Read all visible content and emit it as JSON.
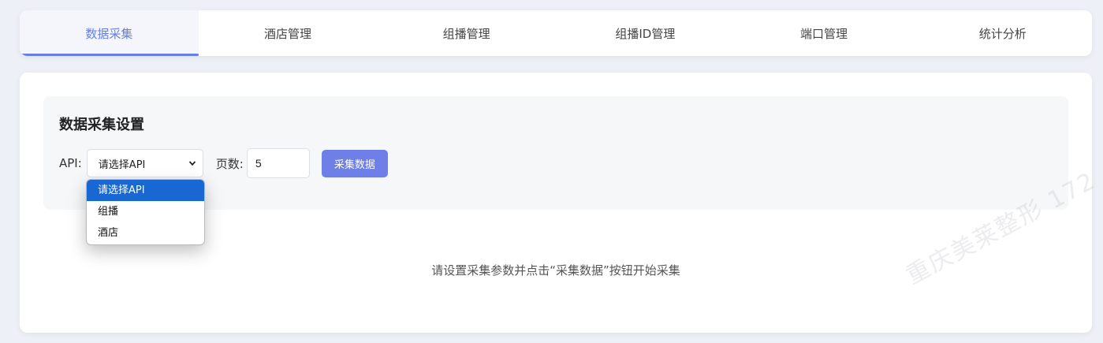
{
  "tabs": [
    {
      "label": "数据采集",
      "active": true
    },
    {
      "label": "酒店管理",
      "active": false
    },
    {
      "label": "组播管理",
      "active": false
    },
    {
      "label": "组播ID管理",
      "active": false
    },
    {
      "label": "端口管理",
      "active": false
    },
    {
      "label": "统计分析",
      "active": false
    }
  ],
  "settings": {
    "title": "数据采集设置",
    "api_label": "API:",
    "api_selected": "请选择API",
    "api_options": [
      "请选择API",
      "组播",
      "酒店"
    ],
    "pages_label": "页数:",
    "pages_value": "5",
    "collect_button": "采集数据"
  },
  "hint": "请设置采集参数并点击“采集数据”按钮开始采集",
  "watermark": "重庆美莱整形 172",
  "colors": {
    "accent": "#667eea",
    "button": "#6f7fe8",
    "option_selected": "#1967d2",
    "page_bg": "#eef0f7"
  }
}
